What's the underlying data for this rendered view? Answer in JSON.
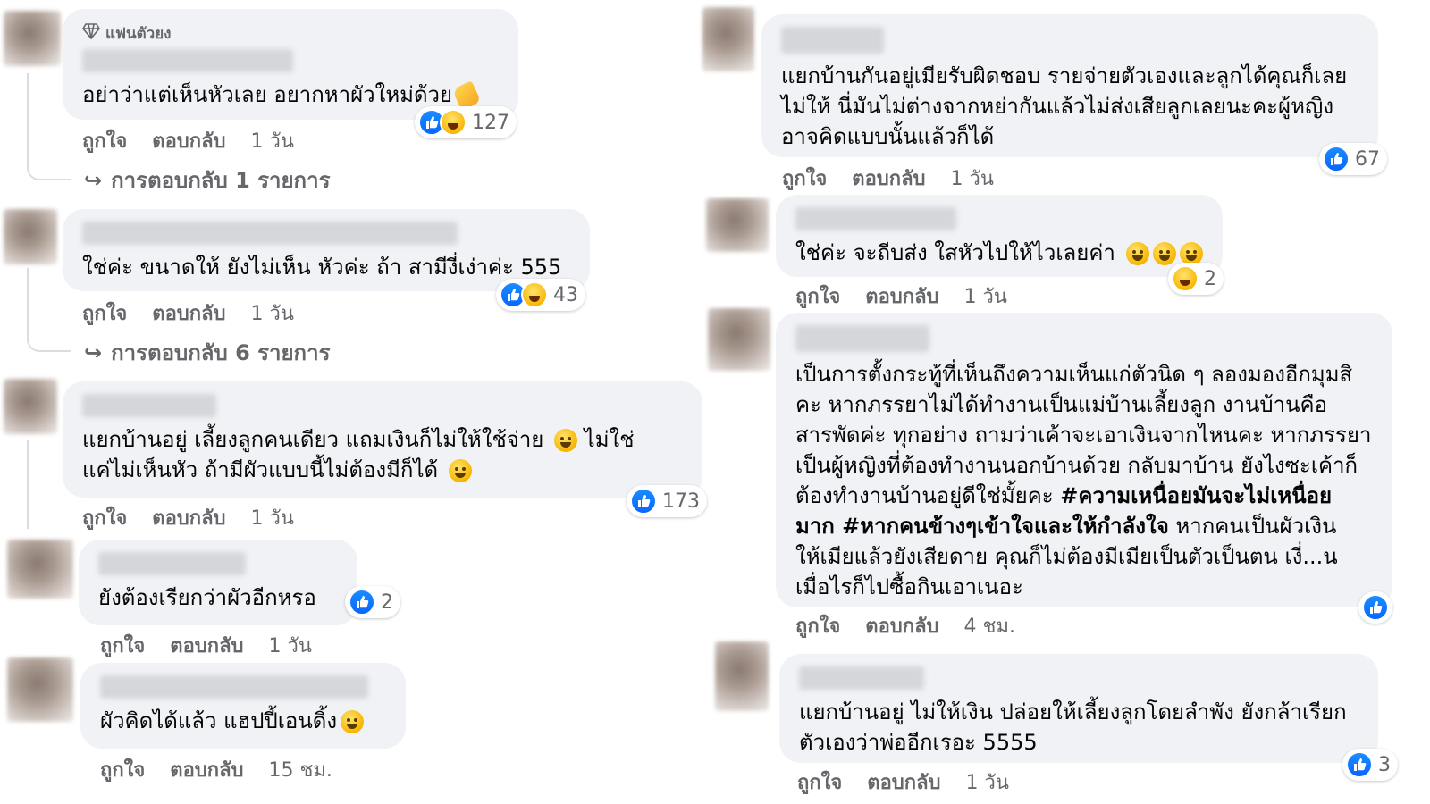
{
  "colors": {
    "bubble": "#f0f2f5",
    "meta": "#65676b",
    "like": "#0866ff"
  },
  "left": {
    "comments": [
      {
        "badge": "แฟนตัวยง",
        "text": "อย่าว่าแต่เห็นหัวเลย อยากหาผัวใหม่ด้วย",
        "reaction_count": "127",
        "like_label": "ถูกใจ",
        "reply_label": "ตอบกลับ",
        "time": "1 วัน",
        "replies": "การตอบกลับ 1 รายการ"
      },
      {
        "text": "ใช่ค่ะ ขนาดให้ ยังไม่เห็น หัวค่ะ ถ้า สามีงี่เง่าค่ะ 555",
        "reaction_count": "43",
        "like_label": "ถูกใจ",
        "reply_label": "ตอบกลับ",
        "time": "1 วัน",
        "replies": "การตอบกลับ 6 รายการ"
      },
      {
        "text_line1": "แยกบ้านอยู่ เลี้ยงลูกคนเดียว แถมเงินก็ไม่ให้ใช้จ่าย",
        "text_line1b": "ไม่ใช่",
        "text_line2": "แค่ไม่เห็นหัว ถ้ามีผัวแบบนี้ไม่ต้องมีก็ได้",
        "reaction_count": "173",
        "like_label": "ถูกใจ",
        "reply_label": "ตอบกลับ",
        "time": "1 วัน"
      },
      {
        "text": "ยังต้องเรียกว่าผัวอีกหรอ",
        "reaction_count": "2",
        "like_label": "ถูกใจ",
        "reply_label": "ตอบกลับ",
        "time": "1 วัน"
      },
      {
        "text": "ผัวคิดได้แล้ว แฮปปี้เอนดิ้ง",
        "like_label": "ถูกใจ",
        "reply_label": "ตอบกลับ",
        "time": "15 ชม."
      }
    ]
  },
  "right": {
    "comments": [
      {
        "line1": "แยกบ้านกันอยู่เมียรับผิดชอบ รายจ่ายตัวเองและลูกได้คุณก็เลย",
        "line2": "ไม่ให้ นี่มันไม่ต่างจากหย่ากันแล้วไม่ส่งเสียลูกเลยนะคะผู้หญิง",
        "line3": "อาจคิดแบบนั้นแล้วก็ได้",
        "reaction_count": "67",
        "like_label": "ถูกใจ",
        "reply_label": "ตอบกลับ",
        "time": "1 วัน"
      },
      {
        "text": "ใช่ค่ะ จะถีบส่ง ใสหัวไปให้ไวเลยค่า",
        "reaction_count": "2",
        "like_label": "ถูกใจ",
        "reply_label": "ตอบกลับ",
        "time": "1 วัน"
      },
      {
        "line1": "เป็นการตั้งกระทู้ที่เห็นถึงความเห็นแก่ตัวนิด ๆ ลองมองอีกมุมสิ",
        "line2": "คะ หากภรรยาไม่ได้ทำงานเป็นแม่บ้านเลี้ยงลูก งานบ้านคือ",
        "line3": "สารพัดค่ะ ทุกอย่าง ถามว่าเค้าจะเอาเงินจากไหนคะ หากภรรยา",
        "line4": "เป็นผู้หญิงที่ต้องทำงานนอกบ้านด้วย กลับมาบ้าน ยังไงซะเค้าก็",
        "line5a": "ต้องทำงานบ้านอยู่ดีใช่มั้ยคะ",
        "line5b": "#ความเหนื่อยมันจะไม่เหนื่อย",
        "line6a": "มาก #หากคนข้างๆเข้าใจและให้กำลังใจ",
        "line6b": "หากคนเป็นผัวเงิน",
        "line7": "ให้เมียแล้วยังเสียดาย คุณก็ไม่ต้องมีเมียเป็นตัวเป็นตน เงี่...น",
        "line8": "เมื่อไรก็ไปซื้อกินเอาเนอะ",
        "like_label": "ถูกใจ",
        "reply_label": "ตอบกลับ",
        "time": "4 ชม."
      },
      {
        "line1": "แยกบ้านอยู่ ไม่ให้เงิน ปล่อยให้เลี้ยงลูกโดยลำพัง ยังกล้าเรียก",
        "line2": "ตัวเองว่าพ่ออีกเรอะ 5555",
        "reaction_count": "3",
        "like_label": "ถูกใจ",
        "reply_label": "ตอบกลับ",
        "time": "1 วัน"
      }
    ]
  }
}
